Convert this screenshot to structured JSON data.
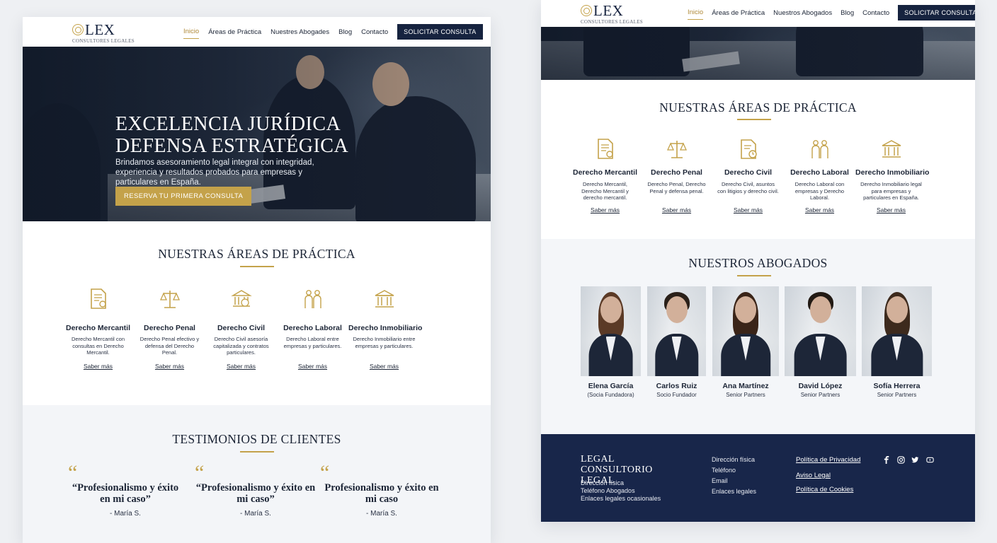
{
  "colors": {
    "navy": "#16233f",
    "gold": "#c4a24a",
    "footer": "#18264a"
  },
  "brand": {
    "word": "LEX",
    "tagline": "CONSULTORES LEGALES"
  },
  "nav": {
    "items": [
      "Inicio",
      "Áreas de Práctica",
      "Nuestres Abogades",
      "Blog",
      "Contacto"
    ],
    "cta": "SOLICITAR CONSULTA"
  },
  "nav_right": {
    "items": [
      "Inicio",
      "Áreas de Práctica",
      "Nuestros Abogados",
      "Blog",
      "Contacto"
    ],
    "cta": "SOLICITAR CONSULTA",
    "tagline": "CONSULTORES LEGALES"
  },
  "hero": {
    "title_1": "EXCELENCIA JURÍDICA",
    "title_2": "DEFENSA ESTRATÉGICA",
    "subtitle": "Brindamos asesoramiento legal integral con integridad, experiencia y resultados probados para empresas y particulares en España.",
    "button": "RESERVA TU PRIMERA CONSULTA"
  },
  "practice": {
    "title": "NUESTRAS ÁREAS DE PRÁCTICA",
    "more": "Saber más",
    "items": [
      {
        "name": "Derecho Mercantil",
        "icon": "document-seal-icon",
        "desc": "Derecho Mercantil con consultas en Derecho Mercantil."
      },
      {
        "name": "Derecho Penal",
        "icon": "scales-icon",
        "desc": "Derecho Penal efectivo y defensa del Derecho Penal."
      },
      {
        "name": "Derecho Civil",
        "icon": "courthouse-icon",
        "desc": "Derecho Civil asesoría capitalizada y contratos particulares."
      },
      {
        "name": "Derecho Laboral",
        "icon": "workers-icon",
        "desc": "Derecho Laboral entre empresas y particulares."
      },
      {
        "name": "Derecho Inmobiliario",
        "icon": "building-icon",
        "desc": "Derecho Inmobiliario entre empresas y particulares."
      }
    ]
  },
  "practice_right": {
    "title": "NUESTRAS ÁREAS DE PRÁCTICA",
    "more": "Saber más",
    "items": [
      {
        "name": "Derecho Mercantil",
        "icon": "document-seal-icon",
        "desc": "Derecho Mercantil, Derecho Mercantil y derecho mercantil."
      },
      {
        "name": "Derecho Penal",
        "icon": "scales-icon",
        "desc": "Derecho Penal, Derecho Penal y defensa penal."
      },
      {
        "name": "Derecho Civil",
        "icon": "document-clock-icon",
        "desc": "Derecho Civil, asuntos con litigios y derecho civil."
      },
      {
        "name": "Derecho Laboral",
        "icon": "workers-icon",
        "desc": "Derecho Laboral con empresas y Derecho Laboral."
      },
      {
        "name": "Derecho Inmobiliario",
        "icon": "building-icon",
        "desc": "Derecho Inmobiliario legal para empresas y particulares en España."
      }
    ]
  },
  "testimonials": {
    "title": "TESTIMONIOS DE CLIENTES",
    "items": [
      {
        "text": "“Profesionalismo y éxito en mi caso”",
        "author": "- María S."
      },
      {
        "text": "“Profesionalismo y éxito en mi caso”",
        "author": "- María S."
      },
      {
        "text": "Profesionalismo y éxito en mi caso",
        "author": "- María S."
      }
    ]
  },
  "lawyers": {
    "title": "NUESTROS ABOGADOS",
    "items": [
      {
        "name": "Elena García",
        "role": "(Socia Fundadora)",
        "gender": "f"
      },
      {
        "name": "Carlos Ruiz",
        "role": "Socio Fundador",
        "gender": "m"
      },
      {
        "name": "Ana Martínez",
        "role": "Senior Partners",
        "gender": "f"
      },
      {
        "name": "David López",
        "role": "Senior Partners",
        "gender": "m"
      },
      {
        "name": "Sofía Herrera",
        "role": "Senior Partners",
        "gender": "f"
      }
    ]
  },
  "footer": {
    "brand": "LEGAL CONSULTORIO LEGAL",
    "brand_lines": [
      "Dirección física",
      "Teléfono Abogados",
      "Enlaces legales ocasionales"
    ],
    "contact": [
      "Dirección física",
      "Teléfono",
      "Email",
      "Enlaces legales"
    ],
    "links": [
      "Política de Privacidad",
      "Aviso Legal",
      "Política de Cookies"
    ],
    "social": [
      "facebook-icon",
      "instagram-icon",
      "twitter-icon",
      "youtube-icon"
    ]
  }
}
